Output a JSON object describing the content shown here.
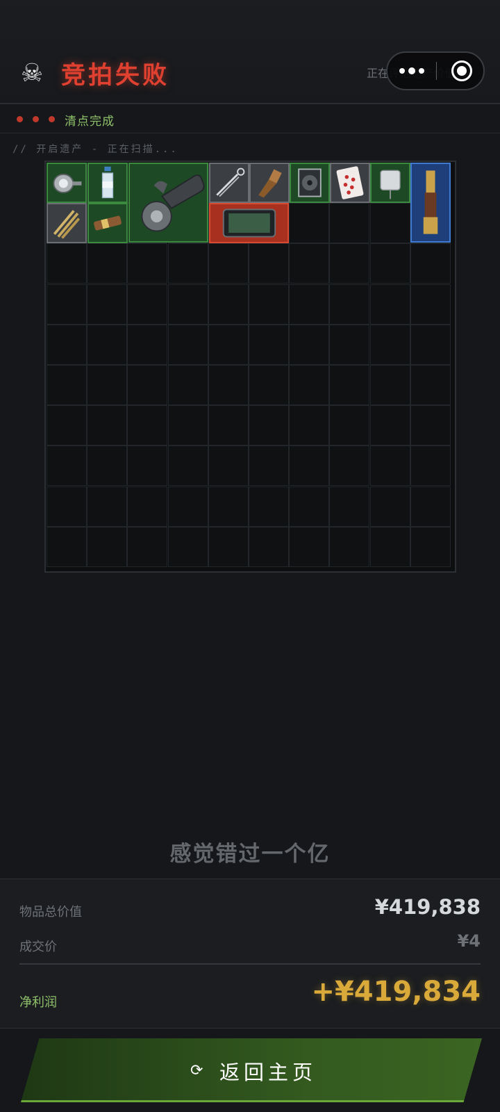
{
  "header": {
    "title": "竞拍失败",
    "skull_icon": "skull-icon",
    "scanning_text": "正在评估遗产价值...",
    "capsule_menu_icon": "more-dots-icon",
    "capsule_close_icon": "target-circle-icon"
  },
  "status": {
    "label": "清点完成",
    "dot_color": "#c0392b"
  },
  "scan_line": "//  开启遗产  -  正在扫描...",
  "grid": {
    "columns": 10,
    "rows": 10,
    "items": [
      {
        "name": "headlamp",
        "rarity": "green"
      },
      {
        "name": "water-bottle",
        "rarity": "green"
      },
      {
        "name": "angle-grinder",
        "rarity": "green"
      },
      {
        "name": "hemostat",
        "rarity": "gray"
      },
      {
        "name": "paint-brush",
        "rarity": "gray"
      },
      {
        "name": "cpu-cooler",
        "rarity": "green"
      },
      {
        "name": "playing-cards",
        "rarity": "gray"
      },
      {
        "name": "iv-bag",
        "rarity": "green"
      },
      {
        "name": "spyglass",
        "rarity": "blue"
      },
      {
        "name": "ropes",
        "rarity": "gray"
      },
      {
        "name": "candy-bar",
        "rarity": "green"
      },
      {
        "name": "tablet",
        "rarity": "red"
      }
    ]
  },
  "quote": "感觉错过一个亿",
  "summary": {
    "total_value_label": "物品总价值",
    "total_value": "¥419,838",
    "deal_price_label": "成交价",
    "deal_price": "¥4",
    "net_profit_label": "净利润",
    "net_profit": "+¥419,834"
  },
  "colors": {
    "title_red": "#e0402f",
    "profit_gold": "#d9a93a",
    "status_green": "#8fc06a",
    "button_green": "#33591f"
  },
  "footer": {
    "return_label": "返回主页",
    "return_icon": "refresh-icon"
  }
}
